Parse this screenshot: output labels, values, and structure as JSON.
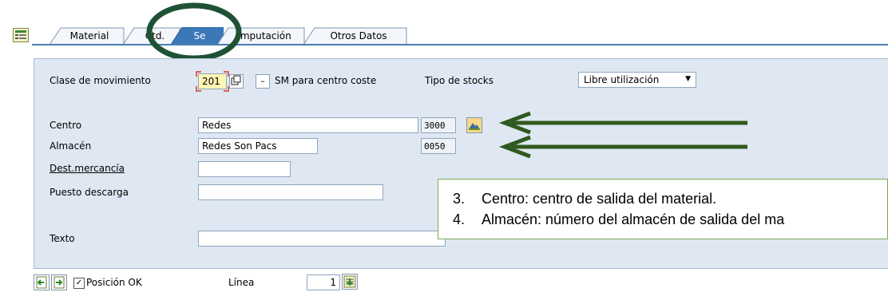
{
  "tabs": [
    {
      "label": "Material",
      "active": false
    },
    {
      "label": "Ctd.",
      "active": false
    },
    {
      "label": "Se",
      "active": true
    },
    {
      "label": "Imputación",
      "active": false
    },
    {
      "label": "Otros Datos",
      "active": false
    }
  ],
  "form": {
    "movement_type_label": "Clase de movimiento",
    "movement_type_value": "201",
    "minus_label": "–",
    "movement_desc": "SM para centro coste",
    "stock_type_label": "Tipo de stocks",
    "stock_type_value": "Libre utilización",
    "plant_label": "Centro",
    "plant_name": "Redes",
    "plant_code": "3000",
    "storage_label": "Almacén",
    "storage_name": "Redes Son Pacs",
    "storage_code": "0050",
    "goods_recipient_label": "Dest.mercancía",
    "goods_recipient_value": "",
    "unloading_point_label": "Puesto descarga",
    "unloading_point_value": "",
    "text_label": "Texto",
    "text_value": ""
  },
  "callout": {
    "line1_num": "3.",
    "line1_text": "Centro: centro de salida del material.",
    "line2_num": "4.",
    "line2_text": "Almacén: número del almacén de salida del ma"
  },
  "footer": {
    "position_ok_label": "Posición OK",
    "position_ok_checked": true,
    "line_label": "Línea",
    "line_value": "1"
  },
  "colors": {
    "panel_bg": "#dfe8f2",
    "tab_active": "#3a78b8",
    "annotation_green": "#2f5a1f",
    "required_field": "#fff7b3"
  },
  "icons": [
    "expand-icon",
    "copy-icon",
    "plant-detail-icon",
    "previous-item-icon",
    "next-item-icon",
    "go-to-line-icon",
    "dropdown-arrow-icon"
  ]
}
